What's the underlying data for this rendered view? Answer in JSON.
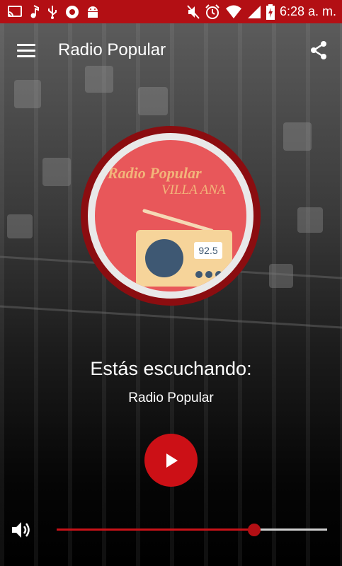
{
  "status_bar": {
    "time": "6:28 a. m.",
    "left_icons": [
      "cast-icon",
      "music-note-icon",
      "usb-icon",
      "record-icon",
      "android-icon"
    ],
    "right_icons": [
      "mute-icon",
      "alarm-icon",
      "wifi-icon",
      "signal-icon",
      "battery-icon"
    ]
  },
  "app_bar": {
    "title": "Radio Popular",
    "menu_icon": "menu-icon",
    "share_icon": "share-icon"
  },
  "logo": {
    "title": "Radio Popular",
    "subtitle": "VILLA ANA",
    "frequency": "92.5"
  },
  "player": {
    "listening_label": "Estás escuchando:",
    "station_name": "Radio Popular",
    "play_icon": "play-icon",
    "volume_icon": "volume-icon",
    "volume_level": 0.73
  },
  "colors": {
    "accent": "#b30f14",
    "play_button": "#cc1016",
    "logo_face": "#e8575a",
    "logo_ring": "#8b0d10"
  }
}
